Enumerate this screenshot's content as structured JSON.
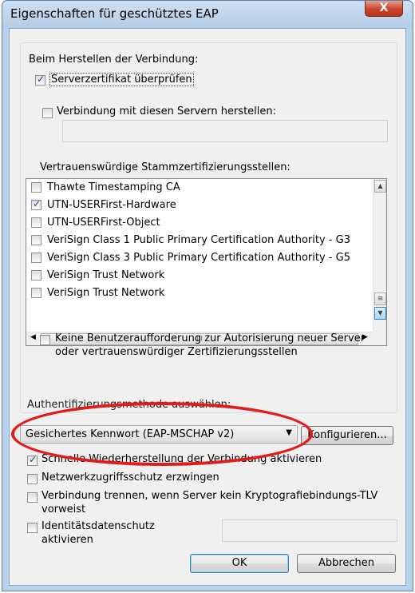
{
  "window": {
    "title": "Eigenschaften für geschütztes EAP",
    "close_glyph": "X"
  },
  "connect_group": {
    "heading": "Beim Herstellen der Verbindung:",
    "verify_cert": {
      "label": "Serverzertifikat überprüfen",
      "checked": true
    },
    "connect_servers": {
      "label": "Verbindung mit diesen Servern herstellen:",
      "checked": false,
      "value": ""
    },
    "root_ca_heading": "Vertrauenswürdige Stammzertifizierungsstellen:",
    "root_cas": [
      {
        "label": "Thawte Timestamping CA",
        "checked": false
      },
      {
        "label": "UTN-USERFirst-Hardware",
        "checked": true
      },
      {
        "label": "UTN-USERFirst-Object",
        "checked": false
      },
      {
        "label": "VeriSign Class 1 Public Primary Certification Authority - G3",
        "checked": false
      },
      {
        "label": "VeriSign Class 3 Public Primary Certification Authority - G5",
        "checked": false
      },
      {
        "label": "VeriSign Trust Network",
        "checked": false
      },
      {
        "label": "VeriSign Trust Network",
        "checked": false
      }
    ],
    "scroll_grip": "III",
    "no_prompt": {
      "label_line1": "Keine Benutzeraufforderung zur Autorisierung neuer Server",
      "label_line2": "oder vertrauenswürdiger Zertifizierungsstellen",
      "checked": false
    }
  },
  "auth": {
    "heading": "Authentifizierungsmethode auswählen:",
    "method_selected": "Gesichertes Kennwort (EAP-MSCHAP v2)",
    "configure_label": "Konfigurieren..."
  },
  "options": {
    "fast_reconnect": {
      "label": "Schnelle Wiederherstellung der Verbindung aktivieren",
      "checked": true
    },
    "nap": {
      "label": "Netzwerkzugriffsschutz erzwingen",
      "checked": false
    },
    "disconnect_tlv": {
      "line1": "Verbindung trennen, wenn Server kein Kryptografiebindungs-TLV",
      "line2": "vorweist",
      "checked": false
    },
    "identity_privacy": {
      "line1": "Identitätsdatenschutz",
      "line2": "aktivieren",
      "checked": false,
      "value": ""
    }
  },
  "buttons": {
    "ok": "OK",
    "cancel": "Abbrechen"
  },
  "colors": {
    "highlight_ellipse": "#e31b1b",
    "titlebar": "#b9d1ea",
    "close_button": "#c9442c"
  }
}
